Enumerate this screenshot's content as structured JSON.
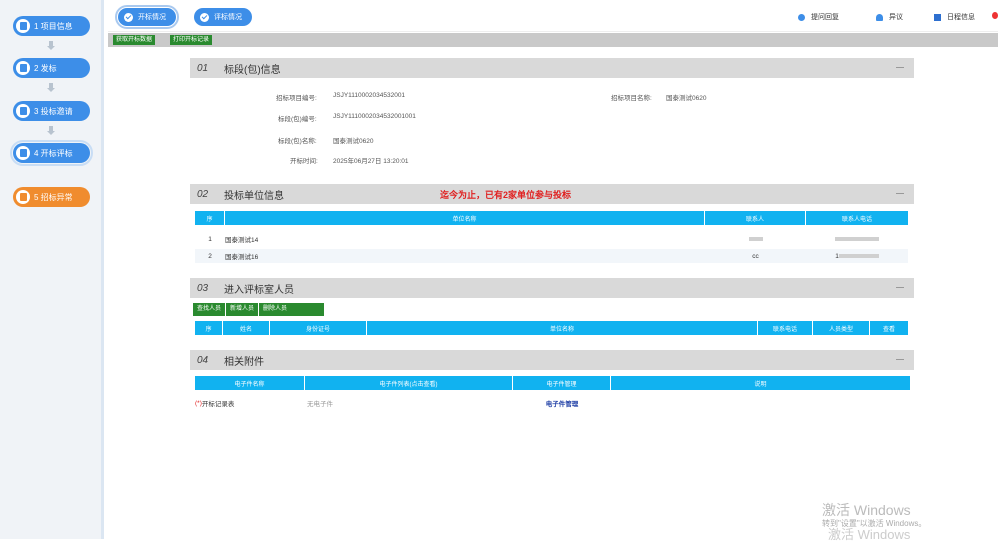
{
  "sidebar": {
    "items": [
      {
        "label": "1 项目信息"
      },
      {
        "label": "2 发标"
      },
      {
        "label": "3 投标邀请"
      },
      {
        "label": "4 开标评标"
      },
      {
        "label": "5 招标异常"
      }
    ]
  },
  "topbar": {
    "tabs": [
      {
        "label": "开标情况"
      },
      {
        "label": "评标情况"
      }
    ],
    "links": [
      {
        "label": "提问回复",
        "icon": "question-dot-icon"
      },
      {
        "label": "异议",
        "icon": "person-icon"
      },
      {
        "label": "日程信息",
        "icon": "calendar-icon"
      }
    ]
  },
  "toolbar": {
    "fetch_label": "获取开标数据",
    "print_label": "打印开标记录"
  },
  "section1": {
    "no": "01",
    "title": "标段(包)信息",
    "fields": {
      "project_no_label": "招标项目编号:",
      "project_no": "JSJY1110002034532001",
      "project_name_label": "招标项目名称:",
      "project_name": "国泰测试0620",
      "bid_no_label": "标段(包)编号:",
      "bid_no": "JSJY1110002034532001001",
      "bid_name_label": "标段(包)名称:",
      "bid_name": "国泰测试0620",
      "open_time_label": "开标时间:",
      "open_time": "2025年06月27日 13:20:01"
    }
  },
  "section2": {
    "no": "02",
    "title": "投标单位信息",
    "notice": "迄今为止，已有2家单位参与投标",
    "headers": [
      "序",
      "单位名称",
      "联系人",
      "联系人电话"
    ],
    "rows": [
      {
        "idx": "1",
        "name": "国泰测试14",
        "contact": "",
        "phone": ""
      },
      {
        "idx": "2",
        "name": "国泰测试16",
        "contact": "cc",
        "phone": "1"
      }
    ]
  },
  "section3": {
    "no": "03",
    "title": "进入评标室人员",
    "buttons": {
      "find": "查找人员",
      "add": "新增人员",
      "remove": "删除人员"
    },
    "headers": [
      "序",
      "姓名",
      "身份证号",
      "单位名称",
      "联系电话",
      "人员类型",
      "查看"
    ]
  },
  "section4": {
    "no": "04",
    "title": "相关附件",
    "headers": [
      "电子件名称",
      "电子件列表(点击查看)",
      "电子件管理",
      "说明"
    ],
    "row": {
      "required_mark": "(*)",
      "name": "开标记录表",
      "list": "无电子件",
      "manage": "电子件管理"
    }
  },
  "watermark": {
    "line1": "激活 Windows",
    "line2": "转到\"设置\"以激活 Windows。",
    "line3": "激活 Windows"
  },
  "colors": {
    "primary": "#3d8ee8",
    "warn": "#f08c2e",
    "table_header": "#11b2f0",
    "green": "#2a8a2f",
    "notice": "#e02020"
  }
}
